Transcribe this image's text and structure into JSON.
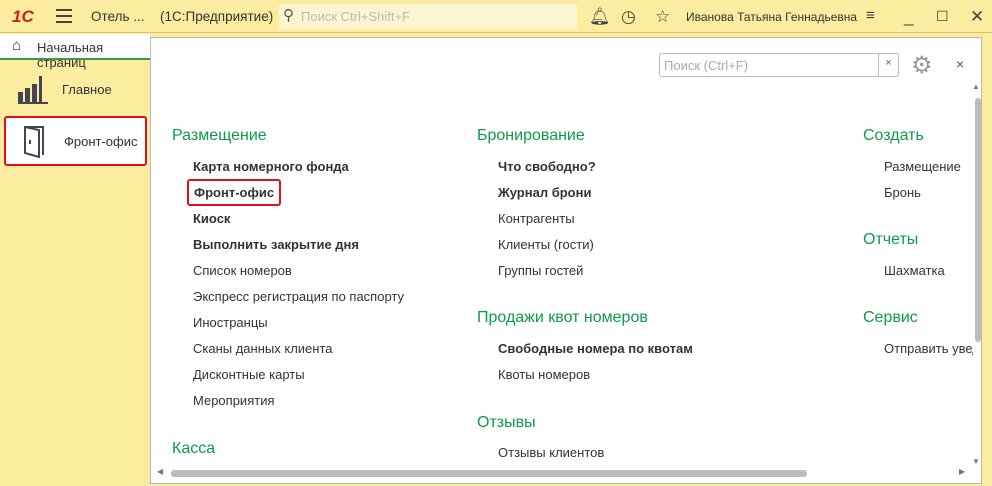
{
  "app": {
    "logo": "1С",
    "title": "Отель ...",
    "platform": "(1С:Предприятие)",
    "search_placeholder": "Поиск Ctrl+Shift+F",
    "user": "Иванова Татьяна Геннадьевна"
  },
  "tab": {
    "label": "Начальная страниц"
  },
  "sidebar": {
    "items": [
      {
        "label": "Главное"
      },
      {
        "label": "Фронт-офис"
      }
    ]
  },
  "panel": {
    "search_placeholder": "Поиск (Ctrl+F)",
    "clear": "×",
    "close": "×"
  },
  "sections": {
    "c1": [
      {
        "title": "Размещение",
        "items": [
          "Карта номерного фонда",
          "Фронт-офис",
          "Киоск",
          "Выполнить закрытие дня",
          "Список номеров",
          "Экспресс регистрация по паспорту",
          "Иностранцы",
          "Сканы данных клиента",
          "Дисконтные карты",
          "Мероприятия"
        ]
      },
      {
        "title": "Касса"
      }
    ],
    "c2": [
      {
        "title": "Бронирование",
        "items": [
          "Что свободно?",
          "Журнал брони",
          "Контрагенты",
          "Клиенты (гости)",
          "Группы гостей"
        ]
      },
      {
        "title": "Продажи квот номеров",
        "items": [
          "Свободные номера по квотам",
          "Квоты номеров"
        ]
      },
      {
        "title": "Отзывы",
        "items": [
          "Отзывы клиентов"
        ]
      }
    ],
    "c3": [
      {
        "title": "Создать",
        "items": [
          "Размещение",
          "Бронь"
        ]
      },
      {
        "title": "Отчеты",
        "items": [
          "Шахматка"
        ]
      },
      {
        "title": "Сервис",
        "items": [
          "Отправить уведомления"
        ]
      }
    ]
  }
}
